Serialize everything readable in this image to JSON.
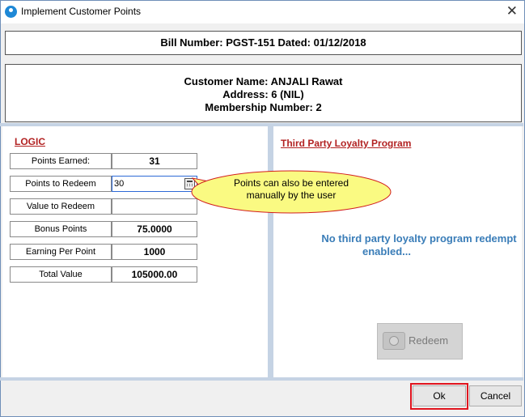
{
  "window": {
    "title": "Implement Customer Points",
    "close_glyph": "✕"
  },
  "bill": {
    "text": "Bill Number: PGST-151 Dated: 01/12/2018"
  },
  "customer": {
    "name_line": "Customer Name: ANJALI  Rawat",
    "address_line": "Address: 6 (NIL)",
    "membership_line": "Membership Number: 2"
  },
  "logic": {
    "heading": "LOGIC",
    "points_earned": {
      "label": "Points Earned:",
      "value": "31"
    },
    "points_to_redeem": {
      "label": "Points to Redeem",
      "value": "30"
    },
    "value_to_redeem": {
      "label": "Value to Redeem",
      "value": ""
    },
    "bonus_points": {
      "label": "Bonus Points",
      "value": "75.0000"
    },
    "earning_per_point": {
      "label": "Earning Per Point",
      "value": "1000"
    },
    "total_value": {
      "label": "Total Value",
      "value": "105000.00"
    }
  },
  "callout": {
    "line1": "Points can also be entered",
    "line2": "manually by the user",
    "fill": "#fafa82",
    "stroke": "#d21e1e"
  },
  "third_party": {
    "heading": "Third Party Loyalty Program",
    "message_line1": "No third party loyalty program redempt",
    "message_line2": "enabled...",
    "redeem_label": "Redeem"
  },
  "footer": {
    "ok_label": "Ok",
    "cancel_label": "Cancel"
  },
  "colors": {
    "heading": "#b22222",
    "message": "#3a7db8",
    "highlight_ring": "#e0141e"
  }
}
